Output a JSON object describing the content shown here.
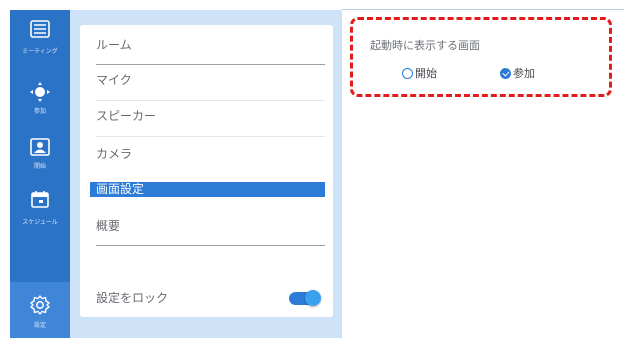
{
  "nav": {
    "items": [
      {
        "label": "ミーティング",
        "icon": "list-icon"
      },
      {
        "label": "参加",
        "icon": "join-icon"
      },
      {
        "label": "開始",
        "icon": "start-icon"
      },
      {
        "label": "スケジュール",
        "icon": "calendar-icon"
      },
      {
        "label": "設定",
        "icon": "gear-icon"
      }
    ]
  },
  "settings_menu": {
    "items": [
      {
        "label": "ルーム"
      },
      {
        "label": "マイク"
      },
      {
        "label": "スピーカー"
      },
      {
        "label": "カメラ"
      },
      {
        "label": "画面設定"
      },
      {
        "label": "概要"
      }
    ],
    "lock_label": "設定をロック",
    "lock_enabled": true
  },
  "screen_settings": {
    "startup_screen_label": "起動時に表示する画面",
    "options": [
      {
        "label": "開始",
        "checked": false
      },
      {
        "label": "参加",
        "checked": true
      }
    ]
  },
  "colors": {
    "accent": "#2d7bd6",
    "highlight": "#e21b1b",
    "rail": "#2b73c6"
  }
}
